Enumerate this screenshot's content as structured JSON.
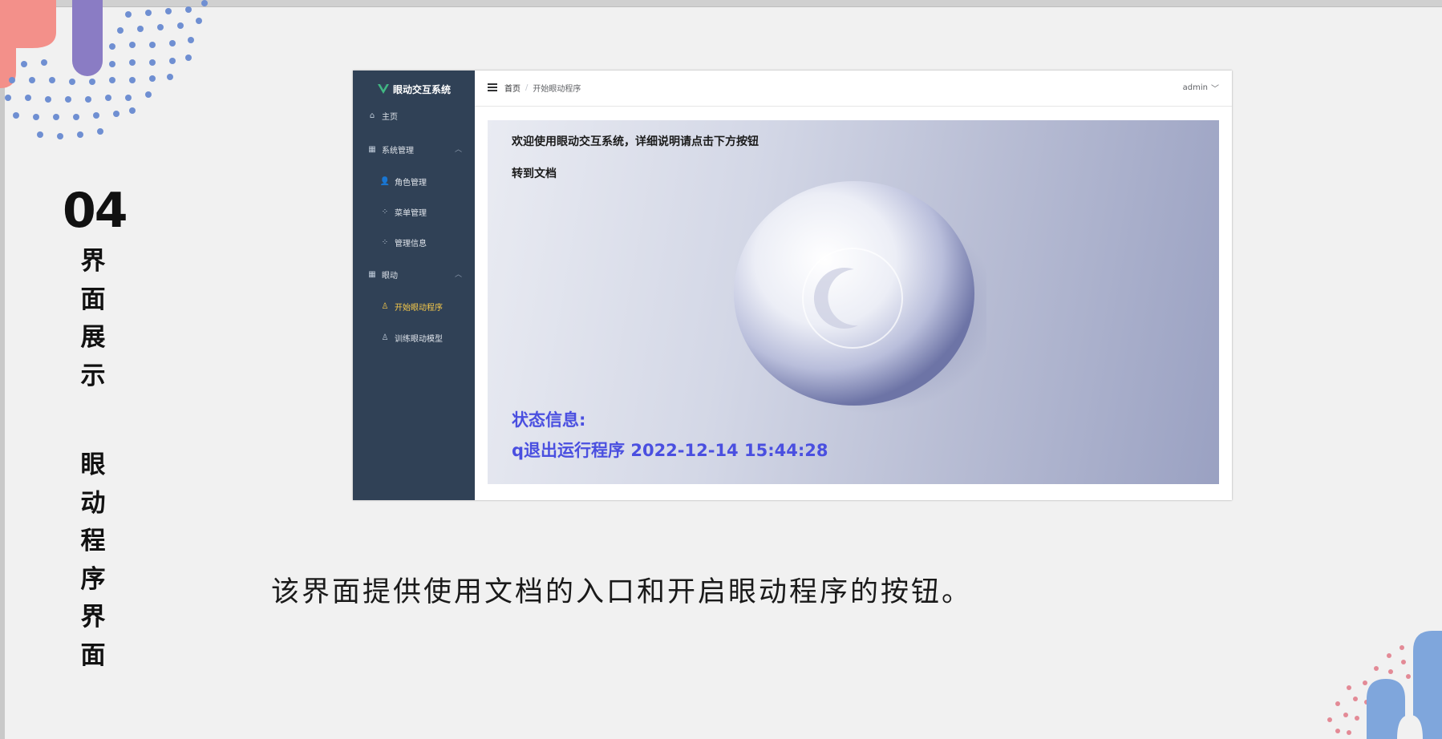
{
  "slide": {
    "section_number": "04",
    "section_title": "界面展示",
    "sub_title": "眼动程序界面",
    "caption": "该界面提供使用文档的入口和开启眼动程序的按钮。"
  },
  "app": {
    "brand_title": "眼动交互系统",
    "sidebar": {
      "home": "主页",
      "system_group": "系统管理",
      "system_items": [
        "角色管理",
        "菜单管理",
        "管理信息"
      ],
      "eye_group": "眼动",
      "eye_items": [
        "开始眼动程序",
        "训练眼动模型"
      ]
    },
    "breadcrumb": {
      "home": "首页",
      "separator": "/",
      "current": "开始眼动程序"
    },
    "user_name": "admin",
    "content": {
      "welcome": "欢迎使用眼动交互系统，详细说明请点击下方按钮",
      "doc_link": "转到文档",
      "status_label": "状态信息:",
      "status_message": "q退出运行程序 2022-12-14 15:44:28"
    }
  },
  "colors": {
    "sidebar_bg": "#304156",
    "active_menu": "#f6c94a",
    "status_text": "#4a4fe0",
    "brand_logo": "#41b883"
  }
}
